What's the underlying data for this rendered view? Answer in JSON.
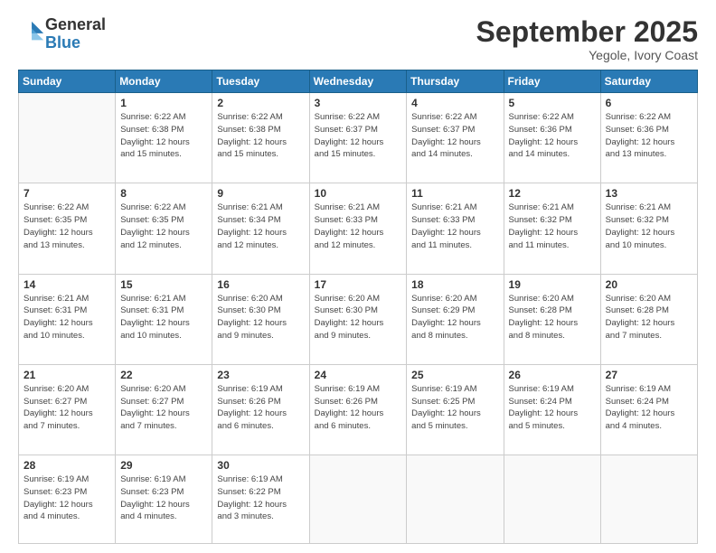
{
  "logo": {
    "general": "General",
    "blue": "Blue"
  },
  "header": {
    "month": "September 2025",
    "location": "Yegole, Ivory Coast"
  },
  "weekdays": [
    "Sunday",
    "Monday",
    "Tuesday",
    "Wednesday",
    "Thursday",
    "Friday",
    "Saturday"
  ],
  "weeks": [
    [
      {
        "day": "",
        "info": ""
      },
      {
        "day": "1",
        "info": "Sunrise: 6:22 AM\nSunset: 6:38 PM\nDaylight: 12 hours\nand 15 minutes."
      },
      {
        "day": "2",
        "info": "Sunrise: 6:22 AM\nSunset: 6:38 PM\nDaylight: 12 hours\nand 15 minutes."
      },
      {
        "day": "3",
        "info": "Sunrise: 6:22 AM\nSunset: 6:37 PM\nDaylight: 12 hours\nand 15 minutes."
      },
      {
        "day": "4",
        "info": "Sunrise: 6:22 AM\nSunset: 6:37 PM\nDaylight: 12 hours\nand 14 minutes."
      },
      {
        "day": "5",
        "info": "Sunrise: 6:22 AM\nSunset: 6:36 PM\nDaylight: 12 hours\nand 14 minutes."
      },
      {
        "day": "6",
        "info": "Sunrise: 6:22 AM\nSunset: 6:36 PM\nDaylight: 12 hours\nand 13 minutes."
      }
    ],
    [
      {
        "day": "7",
        "info": "Sunrise: 6:22 AM\nSunset: 6:35 PM\nDaylight: 12 hours\nand 13 minutes."
      },
      {
        "day": "8",
        "info": "Sunrise: 6:22 AM\nSunset: 6:35 PM\nDaylight: 12 hours\nand 12 minutes."
      },
      {
        "day": "9",
        "info": "Sunrise: 6:21 AM\nSunset: 6:34 PM\nDaylight: 12 hours\nand 12 minutes."
      },
      {
        "day": "10",
        "info": "Sunrise: 6:21 AM\nSunset: 6:33 PM\nDaylight: 12 hours\nand 12 minutes."
      },
      {
        "day": "11",
        "info": "Sunrise: 6:21 AM\nSunset: 6:33 PM\nDaylight: 12 hours\nand 11 minutes."
      },
      {
        "day": "12",
        "info": "Sunrise: 6:21 AM\nSunset: 6:32 PM\nDaylight: 12 hours\nand 11 minutes."
      },
      {
        "day": "13",
        "info": "Sunrise: 6:21 AM\nSunset: 6:32 PM\nDaylight: 12 hours\nand 10 minutes."
      }
    ],
    [
      {
        "day": "14",
        "info": "Sunrise: 6:21 AM\nSunset: 6:31 PM\nDaylight: 12 hours\nand 10 minutes."
      },
      {
        "day": "15",
        "info": "Sunrise: 6:21 AM\nSunset: 6:31 PM\nDaylight: 12 hours\nand 10 minutes."
      },
      {
        "day": "16",
        "info": "Sunrise: 6:20 AM\nSunset: 6:30 PM\nDaylight: 12 hours\nand 9 minutes."
      },
      {
        "day": "17",
        "info": "Sunrise: 6:20 AM\nSunset: 6:30 PM\nDaylight: 12 hours\nand 9 minutes."
      },
      {
        "day": "18",
        "info": "Sunrise: 6:20 AM\nSunset: 6:29 PM\nDaylight: 12 hours\nand 8 minutes."
      },
      {
        "day": "19",
        "info": "Sunrise: 6:20 AM\nSunset: 6:28 PM\nDaylight: 12 hours\nand 8 minutes."
      },
      {
        "day": "20",
        "info": "Sunrise: 6:20 AM\nSunset: 6:28 PM\nDaylight: 12 hours\nand 7 minutes."
      }
    ],
    [
      {
        "day": "21",
        "info": "Sunrise: 6:20 AM\nSunset: 6:27 PM\nDaylight: 12 hours\nand 7 minutes."
      },
      {
        "day": "22",
        "info": "Sunrise: 6:20 AM\nSunset: 6:27 PM\nDaylight: 12 hours\nand 7 minutes."
      },
      {
        "day": "23",
        "info": "Sunrise: 6:19 AM\nSunset: 6:26 PM\nDaylight: 12 hours\nand 6 minutes."
      },
      {
        "day": "24",
        "info": "Sunrise: 6:19 AM\nSunset: 6:26 PM\nDaylight: 12 hours\nand 6 minutes."
      },
      {
        "day": "25",
        "info": "Sunrise: 6:19 AM\nSunset: 6:25 PM\nDaylight: 12 hours\nand 5 minutes."
      },
      {
        "day": "26",
        "info": "Sunrise: 6:19 AM\nSunset: 6:24 PM\nDaylight: 12 hours\nand 5 minutes."
      },
      {
        "day": "27",
        "info": "Sunrise: 6:19 AM\nSunset: 6:24 PM\nDaylight: 12 hours\nand 4 minutes."
      }
    ],
    [
      {
        "day": "28",
        "info": "Sunrise: 6:19 AM\nSunset: 6:23 PM\nDaylight: 12 hours\nand 4 minutes."
      },
      {
        "day": "29",
        "info": "Sunrise: 6:19 AM\nSunset: 6:23 PM\nDaylight: 12 hours\nand 4 minutes."
      },
      {
        "day": "30",
        "info": "Sunrise: 6:19 AM\nSunset: 6:22 PM\nDaylight: 12 hours\nand 3 minutes."
      },
      {
        "day": "",
        "info": ""
      },
      {
        "day": "",
        "info": ""
      },
      {
        "day": "",
        "info": ""
      },
      {
        "day": "",
        "info": ""
      }
    ]
  ]
}
